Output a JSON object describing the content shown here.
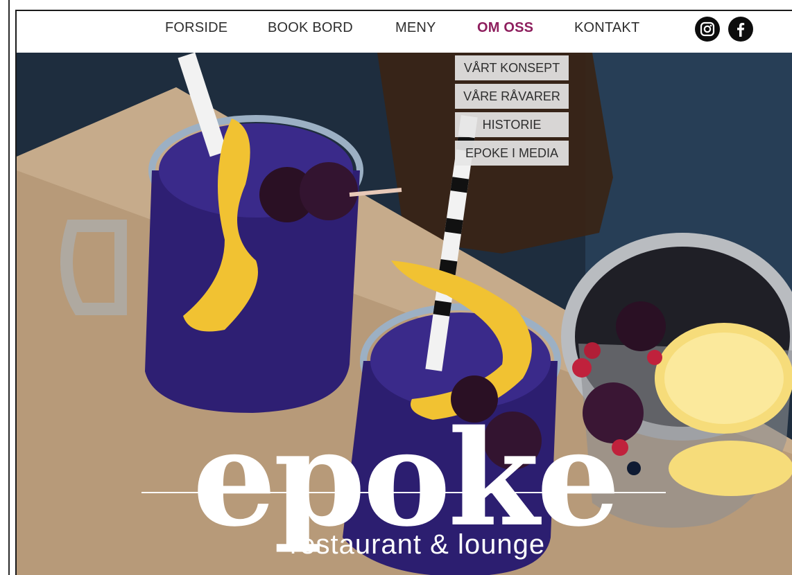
{
  "nav": {
    "items": [
      {
        "label": "FORSIDE"
      },
      {
        "label": "BOOK BORD"
      },
      {
        "label": "MENY"
      },
      {
        "label": "OM OSS"
      },
      {
        "label": "KONTAKT"
      }
    ],
    "active_color": "#8e1f5e",
    "social": [
      "instagram-icon",
      "facebook-icon"
    ]
  },
  "dropdown": {
    "items": [
      "VÅRT KONSEPT",
      "VÅRE RÅVARER",
      "HISTORIE",
      "EPOKE I MEDIA"
    ]
  },
  "logo": {
    "name": "epoke",
    "tagline": "restaurant & lounge"
  }
}
